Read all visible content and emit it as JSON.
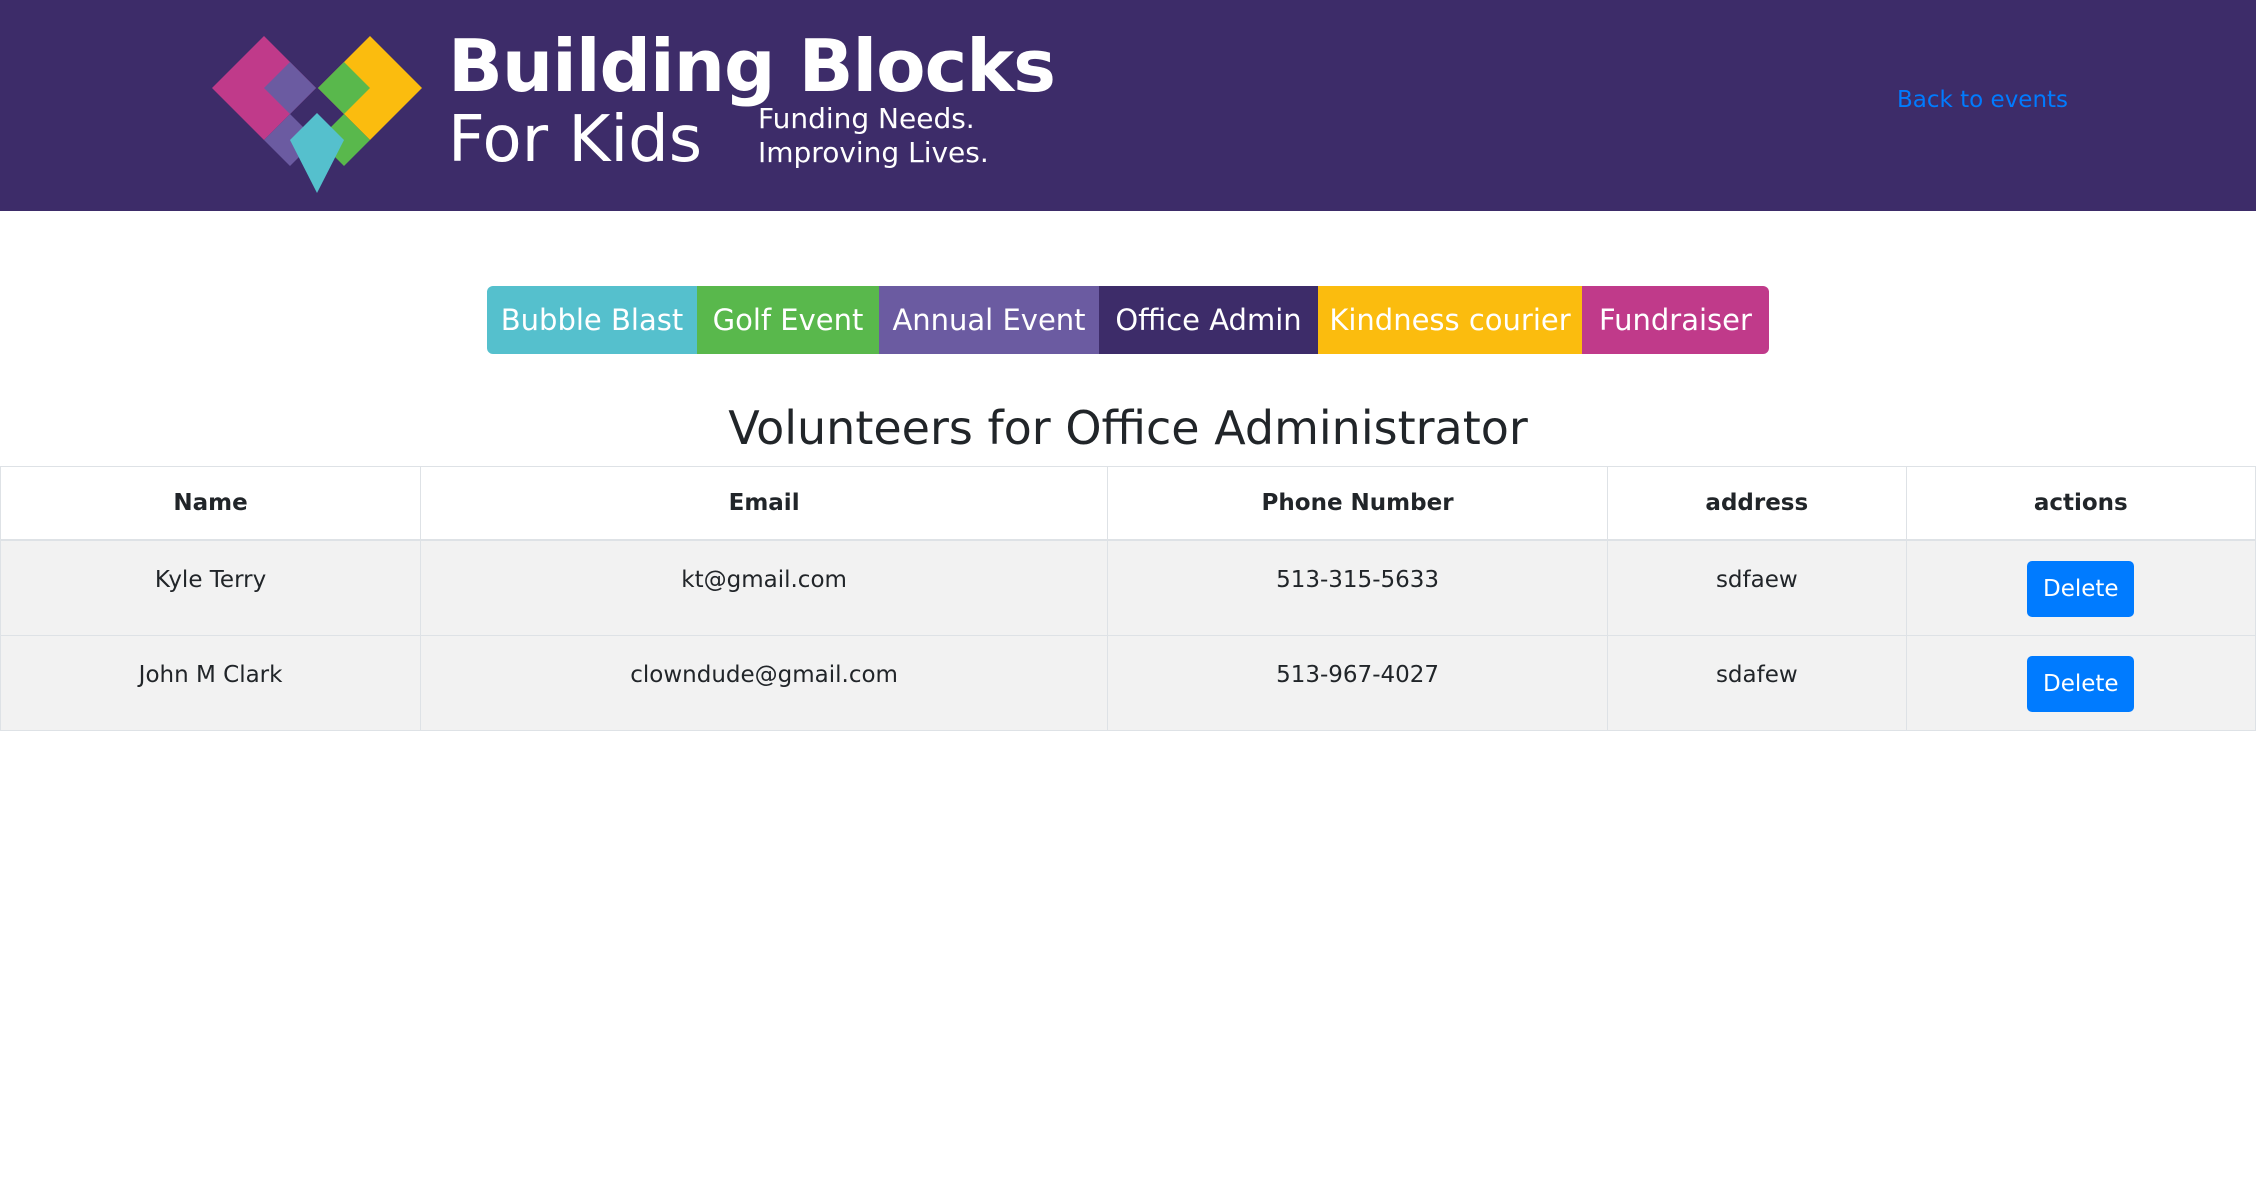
{
  "header": {
    "logo": {
      "line1": "Building Blocks",
      "line2": "For Kids",
      "tagline1": "Funding Needs.",
      "tagline2": "Improving Lives."
    },
    "back_link": "Back to events",
    "colors": {
      "background": "#3d2c69",
      "link": "#007bff"
    }
  },
  "tabs": [
    {
      "label": "Bubble Blast",
      "color": "#55c0cd"
    },
    {
      "label": "Golf Event",
      "color": "#59b84c"
    },
    {
      "label": "Annual Event",
      "color": "#6b5ba1"
    },
    {
      "label": "Office Admin",
      "color": "#3d2c69"
    },
    {
      "label": "Kindness courier",
      "color": "#fbbc0e"
    },
    {
      "label": "Fundraiser",
      "color": "#c03a8a"
    }
  ],
  "page_title": "Volunteers for Office Administrator",
  "table": {
    "headers": [
      "Name",
      "Email",
      "Phone Number",
      "address",
      "actions"
    ],
    "rows": [
      {
        "name": "Kyle Terry",
        "email": "kt@gmail.com",
        "phone": "513-315-5633",
        "address": "sdfaew",
        "action": "Delete"
      },
      {
        "name": "John M Clark",
        "email": "clowndude@gmail.com",
        "phone": "513-967-4027",
        "address": "sdafew",
        "action": "Delete"
      }
    ]
  },
  "button_color": "#007bff"
}
